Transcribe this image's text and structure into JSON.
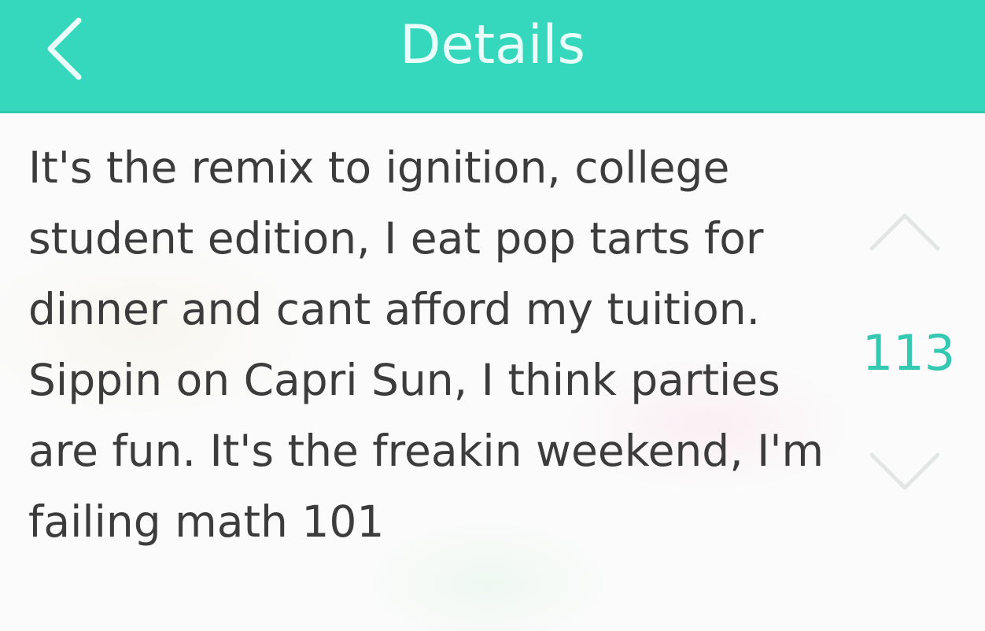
{
  "header": {
    "title": "Details",
    "back_icon": "chevron-left-icon"
  },
  "post": {
    "text": "It's the remix to ignition, college student edition, I eat pop tarts for dinner and cant afford my tuition. Sippin on Capri Sun, I think parties are fun. It's the freakin weekend, I'm failing math 101"
  },
  "votes": {
    "count": "113",
    "upvote_icon": "chevron-up-icon",
    "downvote_icon": "chevron-down-icon"
  },
  "colors": {
    "accent": "#35d7bd",
    "vote_count": "#35c9b2",
    "text": "#3c3c3c"
  }
}
